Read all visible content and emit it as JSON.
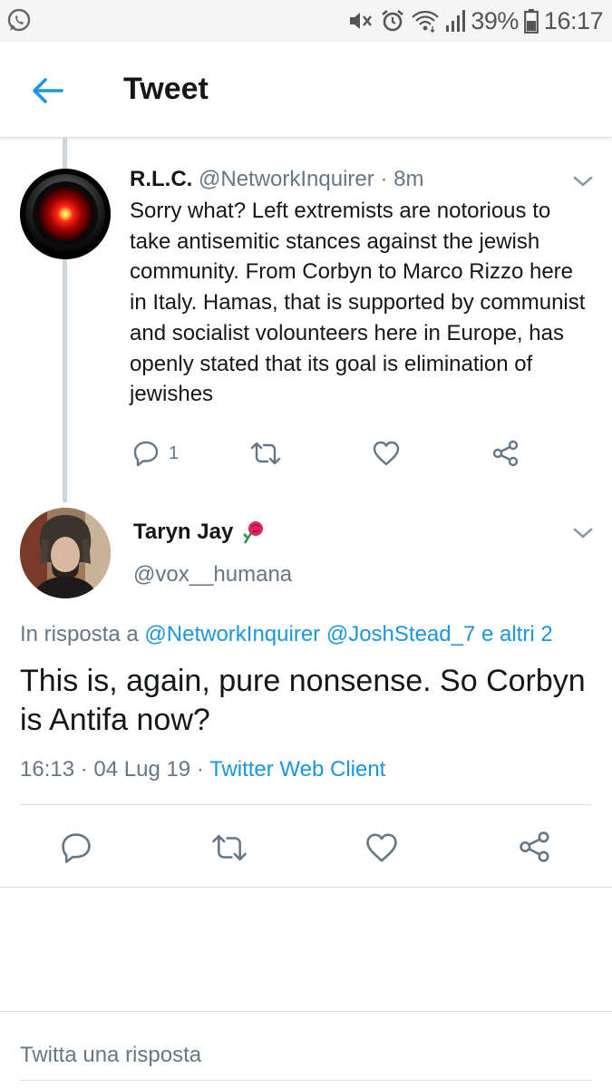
{
  "status_bar": {
    "battery": "39%",
    "time": "16:17"
  },
  "header": {
    "title": "Tweet"
  },
  "parent_tweet": {
    "name": "R.L.C.",
    "handle": "@NetworkInquirer",
    "separator": "·",
    "time": "8m",
    "text": "Sorry what? Left extremists are notorious to take antisemitic stances against the jewish community. From Corbyn to Marco Rizzo here in Italy. Hamas, that is supported by communist and socialist volounteers here in Europe, has openly stated that its goal is elimination of jewishes",
    "reply_count": "1"
  },
  "main_tweet": {
    "name": "Taryn Jay",
    "handle": "@vox__humana",
    "reply_prefix": "In risposta a",
    "reply_to": "@NetworkInquirer @JoshStead_7 e altri 2",
    "text": "This is, again, pure nonsense. So Corbyn is Antifa now?",
    "timestamp": "16:13 · 04 Lug 19 · ",
    "client": "Twitter Web Client"
  },
  "composer": {
    "placeholder": "Twitta una risposta"
  },
  "colors": {
    "accent": "#1b95e0",
    "secondary_text": "#657786",
    "icon": "#657786"
  }
}
